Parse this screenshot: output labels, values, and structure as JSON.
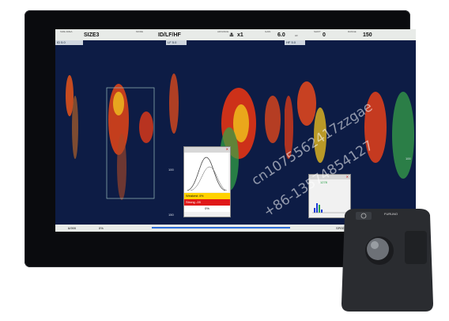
{
  "topbar": {
    "label1": "SIZE AREA",
    "size_value": "SIZE3",
    "label2": "MODE",
    "mode_value": "ID/LF/HF",
    "label3": "ADVANCE",
    "advance_value": "x1",
    "label4": "GAIN",
    "gain_value": "6.0",
    "gain_unit": "HF",
    "label5": "SHIFT",
    "shift_value": "0",
    "label6": "RANGE",
    "range_value": "150"
  },
  "panels": [
    {
      "label": "ID",
      "value": "5.0"
    },
    {
      "label": "LF",
      "value": "5.0"
    },
    {
      "label": "HF",
      "value": "5.0"
    }
  ],
  "depth_scale": {
    "mid": "100",
    "bottom": "150"
  },
  "depth_scale_right": {
    "mid": "100",
    "bottom": "150"
  },
  "popup_a": {
    "row1": "Weakest",
    "row1_value": "4%",
    "row2": "Strong",
    "row2_value": "-28",
    "row3_value": "0%"
  },
  "popup_b": {
    "value": "1278"
  },
  "bottombar": {
    "counter": "6/999",
    "percent": "0%",
    "right_text": "SPEED"
  },
  "trackball": {
    "brand": "FURUNO"
  },
  "watermark": {
    "line1": "cn1075562417zzgae",
    "line2": "+86-13574854127"
  },
  "colors": {
    "screen": "#0d1c45",
    "echo_hot": "#ff3b12",
    "echo_mid": "#f0c020",
    "echo_low": "#2fa84a"
  }
}
